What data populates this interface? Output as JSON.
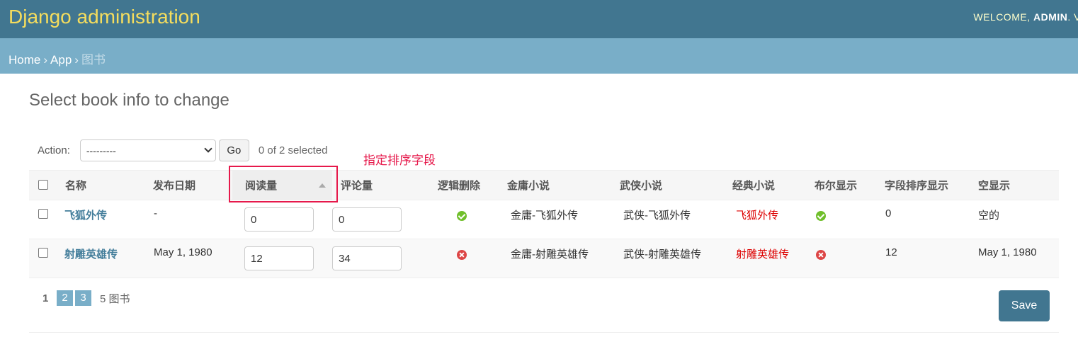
{
  "header": {
    "branding": "Django administration",
    "welcome": "WELCOME,",
    "username": "ADMIN",
    "trailing": ". V"
  },
  "breadcrumbs": {
    "home": "Home",
    "app": "App",
    "current": "图书",
    "separator": "›"
  },
  "page_title": "Select book info to change",
  "actions": {
    "label": "Action:",
    "selected_value": "---------",
    "go_label": "Go",
    "counter": "0 of 2 selected"
  },
  "annotation": {
    "text": "指定排序字段",
    "color": "#e6194b"
  },
  "table": {
    "columns": [
      "名称",
      "发布日期",
      "阅读量",
      "评论量",
      "逻辑删除",
      "金庸小说",
      "武侠小说",
      "经典小说",
      "布尔显示",
      "字段排序显示",
      "空显示"
    ],
    "sorted_column": "阅读量",
    "rows": [
      {
        "name": "飞狐外传",
        "pub_date": "-",
        "read": "0",
        "comment": "0",
        "deleted": "yes",
        "jinyong": "金庸-飞狐外传",
        "wuxia": "武侠-飞狐外传",
        "classic": "飞狐外传",
        "bool": "yes",
        "sort_display": "0",
        "empty_display": "空的"
      },
      {
        "name": "射雕英雄传",
        "pub_date": "May 1, 1980",
        "read": "12",
        "comment": "34",
        "deleted": "no",
        "jinyong": "金庸-射雕英雄传",
        "wuxia": "武侠-射雕英雄传",
        "classic": "射雕英雄传",
        "bool": "no",
        "sort_display": "12",
        "empty_display": "May 1, 1980"
      }
    ]
  },
  "paginator": {
    "current_page": "1",
    "pages": [
      "2",
      "3"
    ],
    "count": "5 图书"
  },
  "save_label": "Save",
  "colors": {
    "header_bg": "#417690",
    "breadcrumb_bg": "#79aec8",
    "branding": "#f5dd5d",
    "link": "#447e9b",
    "classic_text": "#dd0000"
  }
}
